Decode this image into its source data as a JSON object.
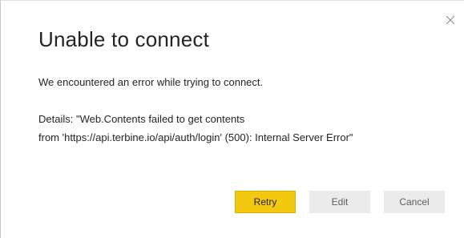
{
  "dialog": {
    "title": "Unable to connect",
    "message": "We encountered an error while trying to connect.",
    "details_line1": "Details: \"Web.Contents failed to get contents",
    "details_line2": "from 'https://api.terbine.io/api/auth/login' (500): Internal Server Error\"",
    "close_icon": "close-icon"
  },
  "buttons": {
    "retry_label": "Retry",
    "edit_label": "Edit",
    "cancel_label": "Cancel"
  },
  "colors": {
    "primary_button": "#f2c811",
    "secondary_button": "#ebebeb",
    "text": "#252423"
  }
}
